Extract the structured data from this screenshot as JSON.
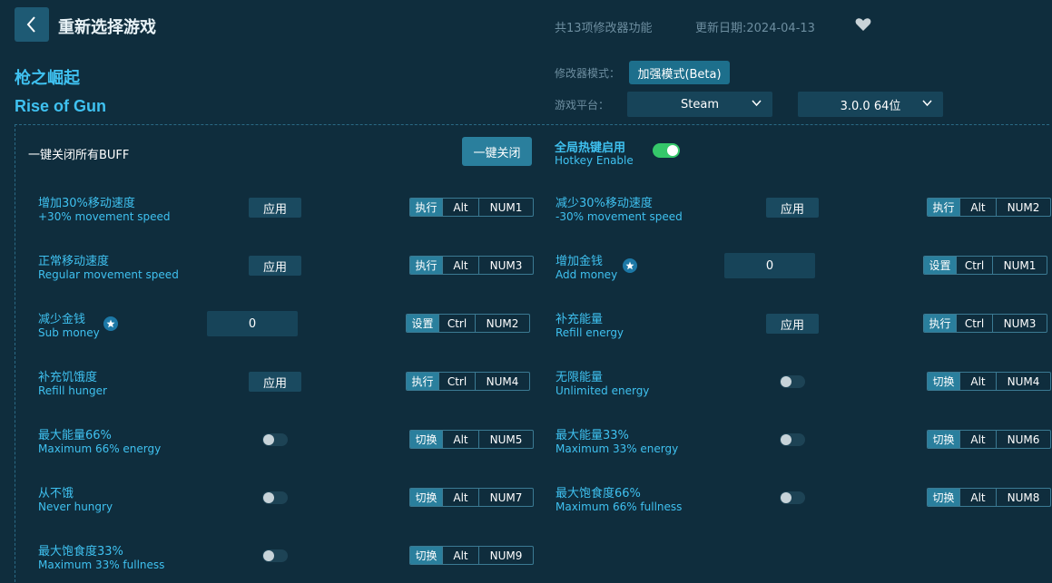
{
  "header": {
    "back_icon": "chevron-left-icon",
    "title": "重新选择游戏",
    "feature_count": "共13项修改器功能",
    "update_date": "更新日期:2024-04-13",
    "favorite_icon": "heart-icon"
  },
  "game": {
    "name_cn": "枪之崛起",
    "name_en": "Rise of Gun"
  },
  "settings": {
    "mode_label": "修改器模式：",
    "mode_value": "加强模式(Beta)",
    "platform_label": "游戏平台：",
    "platform_value": "Steam",
    "version_value": "3.0.0 64位"
  },
  "top": {
    "buff_label": "一键关闭所有BUFF",
    "close_all": "一键关闭",
    "hotkey_cn": "全局热键启用",
    "hotkey_en": "Hotkey Enable",
    "hotkey_enabled": true
  },
  "cheats": [
    {
      "cn": "增加30%移动速度",
      "en": "+30% movement speed",
      "control": "apply",
      "control_label": "应用",
      "action": "执行",
      "mod": "Alt",
      "key": "NUM1"
    },
    {
      "cn": "减少30%移动速度",
      "en": "-30% movement speed",
      "control": "apply",
      "control_label": "应用",
      "action": "执行",
      "mod": "Alt",
      "key": "NUM2"
    },
    {
      "cn": "正常移动速度",
      "en": "Regular movement speed",
      "control": "apply",
      "control_label": "应用",
      "action": "执行",
      "mod": "Alt",
      "key": "NUM3"
    },
    {
      "cn": "增加金钱",
      "en": "Add money",
      "control": "input",
      "control_label": "0",
      "action": "设置",
      "mod": "Ctrl",
      "key": "NUM1"
    },
    {
      "cn": "减少金钱",
      "en": "Sub money",
      "control": "input",
      "control_label": "0",
      "action": "设置",
      "mod": "Ctrl",
      "key": "NUM2"
    },
    {
      "cn": "补充能量",
      "en": "Refill energy",
      "control": "apply",
      "control_label": "应用",
      "action": "执行",
      "mod": "Ctrl",
      "key": "NUM3"
    },
    {
      "cn": "补充饥饿度",
      "en": "Refill hunger",
      "control": "apply",
      "control_label": "应用",
      "action": "执行",
      "mod": "Ctrl",
      "key": "NUM4"
    },
    {
      "cn": "无限能量",
      "en": "Unlimited energy",
      "control": "toggle",
      "action": "切换",
      "mod": "Alt",
      "key": "NUM4"
    },
    {
      "cn": "最大能量66%",
      "en": "Maximum 66% energy",
      "control": "toggle",
      "action": "切换",
      "mod": "Alt",
      "key": "NUM5"
    },
    {
      "cn": "最大能量33%",
      "en": "Maximum 33% energy",
      "control": "toggle",
      "action": "切换",
      "mod": "Alt",
      "key": "NUM6"
    },
    {
      "cn": "从不饿",
      "en": "Never hungry",
      "control": "toggle",
      "action": "切换",
      "mod": "Alt",
      "key": "NUM7"
    },
    {
      "cn": "最大饱食度66%",
      "en": "Maximum 66% fullness",
      "control": "toggle",
      "action": "切换",
      "mod": "Alt",
      "key": "NUM8"
    },
    {
      "cn": "最大饱食度33%",
      "en": "Maximum 33% fullness",
      "control": "toggle",
      "action": "切换",
      "mod": "Alt",
      "key": "NUM9"
    }
  ],
  "colors": {
    "background": "#0f2d3d",
    "accent": "#3fc1f0",
    "button": "#2a7f9d",
    "toggle_on": "#35c76a"
  }
}
